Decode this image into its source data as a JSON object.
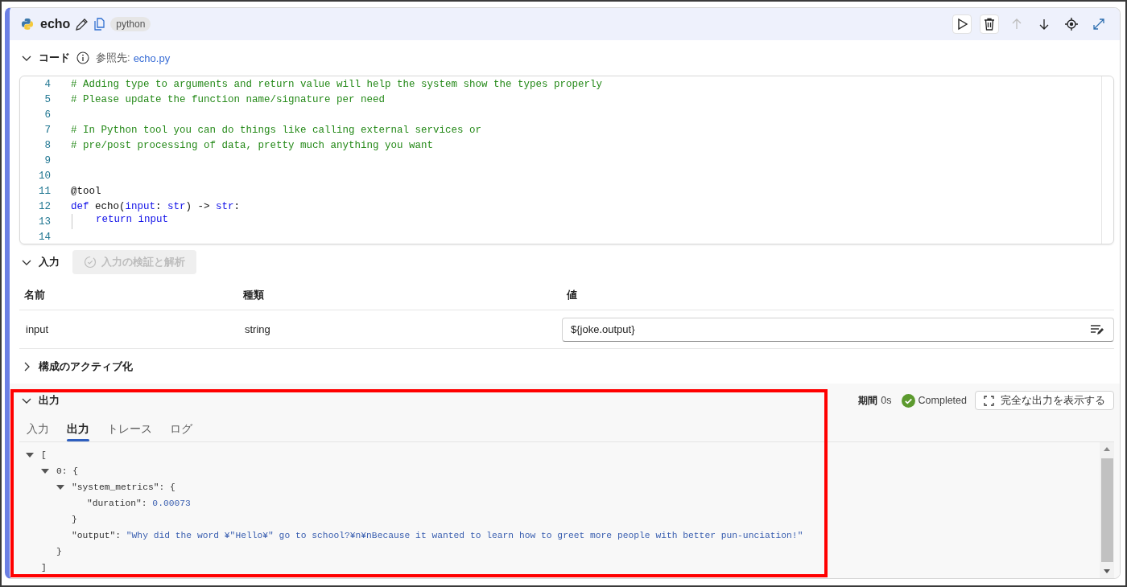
{
  "node": {
    "title": "echo",
    "language": "python",
    "toolbar": [
      {
        "kind": "run",
        "disabled": false
      },
      {
        "kind": "delete",
        "disabled": false
      },
      {
        "kind": "move-up",
        "disabled": true
      },
      {
        "kind": "move-down",
        "disabled": false
      },
      {
        "kind": "locate",
        "disabled": false
      },
      {
        "kind": "expand",
        "disabled": false
      }
    ]
  },
  "code_section": {
    "title": "コード",
    "expanded": true,
    "reference_label": "参照先:",
    "reference_link": "echo.py",
    "lines": [
      {
        "number": "4",
        "tokens": [
          {
            "kind": "comment",
            "text": "# Adding type to arguments and return value will help the system show the types properly"
          }
        ]
      },
      {
        "number": "5",
        "tokens": [
          {
            "kind": "comment",
            "text": "# Please update the function name/signature per need"
          }
        ]
      },
      {
        "number": "6"
      },
      {
        "number": "7",
        "tokens": [
          {
            "kind": "comment",
            "text": "# In Python tool you can do things like calling external services or"
          }
        ]
      },
      {
        "number": "8",
        "tokens": [
          {
            "kind": "comment",
            "text": "# pre/post processing of data, pretty much anything you want"
          }
        ]
      },
      {
        "number": "9"
      },
      {
        "number": "10"
      },
      {
        "number": "11",
        "tokens": [
          {
            "kind": "plain",
            "text": "@tool"
          }
        ]
      },
      {
        "number": "12",
        "tokens": [
          {
            "kind": "keyword",
            "text": "def"
          },
          {
            "kind": "plain",
            "text": " echo("
          },
          {
            "kind": "keyword",
            "text": "input"
          },
          {
            "kind": "plain",
            "text": ": "
          },
          {
            "kind": "keyword",
            "text": "str"
          },
          {
            "kind": "plain",
            "text": ") -> "
          },
          {
            "kind": "keyword",
            "text": "str"
          },
          {
            "kind": "plain",
            "text": ":"
          }
        ]
      },
      {
        "number": "13",
        "indent": true,
        "tokens": [
          {
            "kind": "keyword",
            "text": "return input"
          }
        ]
      },
      {
        "number": "14"
      }
    ]
  },
  "input_section": {
    "title": "入力",
    "expanded": true,
    "validate_button": {
      "label": "入力の検証と解析",
      "disabled": true
    },
    "columns": [
      "名前",
      "種類",
      "値"
    ],
    "rows": [
      {
        "name": "input",
        "type": "string",
        "value": "${joke.output}"
      }
    ]
  },
  "activation_section": {
    "title": "構成のアクティブ化",
    "expanded": false
  },
  "output_section": {
    "title": "出力",
    "expanded": true,
    "duration_label": "期間",
    "duration": "0s",
    "status": "Completed",
    "full_output_button": "完全な出力を表示する",
    "tabs": [
      {
        "label": "入力",
        "selected": false
      },
      {
        "label": "出力",
        "selected": true
      },
      {
        "label": "トレース",
        "selected": false
      },
      {
        "label": "ログ",
        "selected": false
      }
    ],
    "tree": {
      "open": "[",
      "expanded": true,
      "close": "]",
      "children": [
        {
          "key": "0:",
          "open": "{",
          "expanded": true,
          "close": "}",
          "children": [
            {
              "key": "\"system_metrics\":",
              "open": "{",
              "expanded": true,
              "close": "}",
              "children": [
                {
                  "key": "\"duration\":",
                  "value": "0.00073"
                }
              ]
            },
            {
              "key": "\"output\":",
              "value": "\"Why did the word ¥\"Hello¥\" go to school?¥n¥nBecause it wanted to learn how to greet more people with better pun-unciation!\""
            }
          ]
        }
      ]
    }
  }
}
